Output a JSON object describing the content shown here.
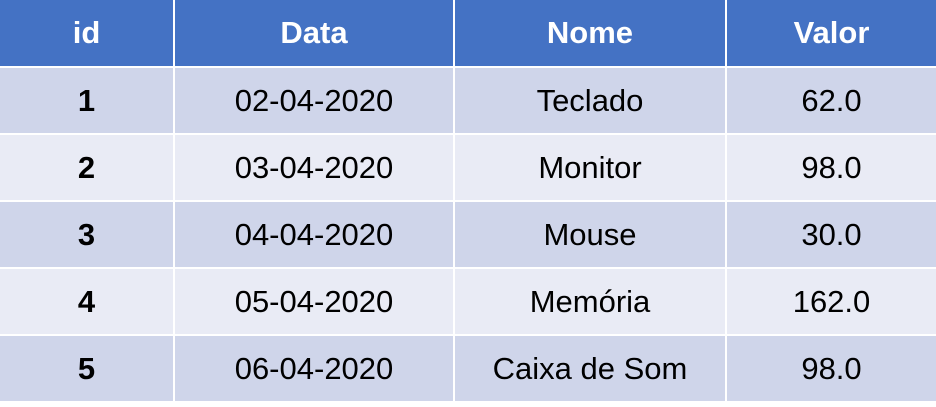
{
  "table": {
    "columns": [
      "id",
      "Data",
      "Nome",
      "Valor"
    ],
    "rows": [
      {
        "id": "1",
        "data": "02-04-2020",
        "nome": "Teclado",
        "valor": "62.0"
      },
      {
        "id": "2",
        "data": "03-04-2020",
        "nome": "Monitor",
        "valor": "98.0"
      },
      {
        "id": "3",
        "data": "04-04-2020",
        "nome": "Mouse",
        "valor": "30.0"
      },
      {
        "id": "4",
        "data": "05-04-2020",
        "nome": "Memória",
        "valor": "162.0"
      },
      {
        "id": "5",
        "data": "06-04-2020",
        "nome": "Caixa de Som",
        "valor": "98.0"
      }
    ]
  },
  "colors": {
    "header_bg": "#4472c4",
    "row_odd_bg": "#cfd5ea",
    "row_even_bg": "#e9ebf5",
    "header_text": "#ffffff"
  }
}
